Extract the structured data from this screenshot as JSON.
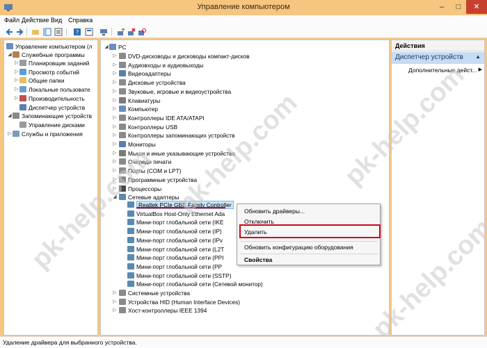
{
  "window": {
    "title": "Управление компьютером",
    "min": "–",
    "max": "□",
    "close": "✕"
  },
  "menu": [
    "Файл",
    "Действие",
    "Вид",
    "Справка"
  ],
  "left_tree": [
    "Управление компьютером (л",
    "Служебные программы",
    "Планировщик заданий",
    "Просмотр событий",
    "Общие папки",
    "Локальные пользовате",
    "Производительность",
    "Диспетчер устройств",
    "Запоминающие устройств",
    "Управление дисками",
    "Службы и приложения"
  ],
  "device_tree": {
    "root": "PC",
    "categories": [
      "DVD-дисководы и дисководы компакт-дисков",
      "Аудиовходы и аудиовыходы",
      "Видеоадаптеры",
      "Дисковые устройства",
      "Звуковые, игровые и видеоустройства",
      "Клавиатуры",
      "Компьютер",
      "Контроллеры IDE ATA/ATAPI",
      "Контроллеры USB",
      "Контроллеры запоминающих устройств",
      "Мониторы",
      "Мыши и иные указывающие устройства",
      "Очереди печати",
      "Порты (COM и LPT)",
      "Программные устройства",
      "Процессоры",
      "Сетевые адаптеры"
    ],
    "network_adapters": [
      "Realtek PCIe GBE Family Controller",
      "VirtualBox Host-Only Ethernet Ada",
      "Мини-порт глобальной сети (IKE",
      "Мини-порт глобальной сети (IP)",
      "Мини-порт глобальной сети (IPv",
      "Мини-порт глобальной сети (L2T",
      "Мини-порт глобальной сети (PPI",
      "Мини-порт глобальной сети (PP",
      "Мини-порт глобальной сети (SSTP)",
      "Мини-порт глобальной сети (Сетевой монитор)"
    ],
    "after": [
      "Системные устройства",
      "Устройства HID (Human Interface Devices)",
      "Хост-контроллеры IEEE 1394"
    ]
  },
  "context_menu": {
    "update": "Обновить драйверы...",
    "disable": "Отключить",
    "delete": "Удалить",
    "scan": "Обновить конфигурацию оборудования",
    "properties": "Свойства"
  },
  "actions_pane": {
    "header": "Действия",
    "selected": "Диспетчер устройств",
    "more": "Дополнительные дейст..."
  },
  "status": "Удаление драйвера для выбранного устройства.",
  "watermark": "pk-help.com",
  "colors": {
    "title_bar": "#f6c57f",
    "highlight_red": "#d0021b",
    "selection": "#cde6f7"
  }
}
